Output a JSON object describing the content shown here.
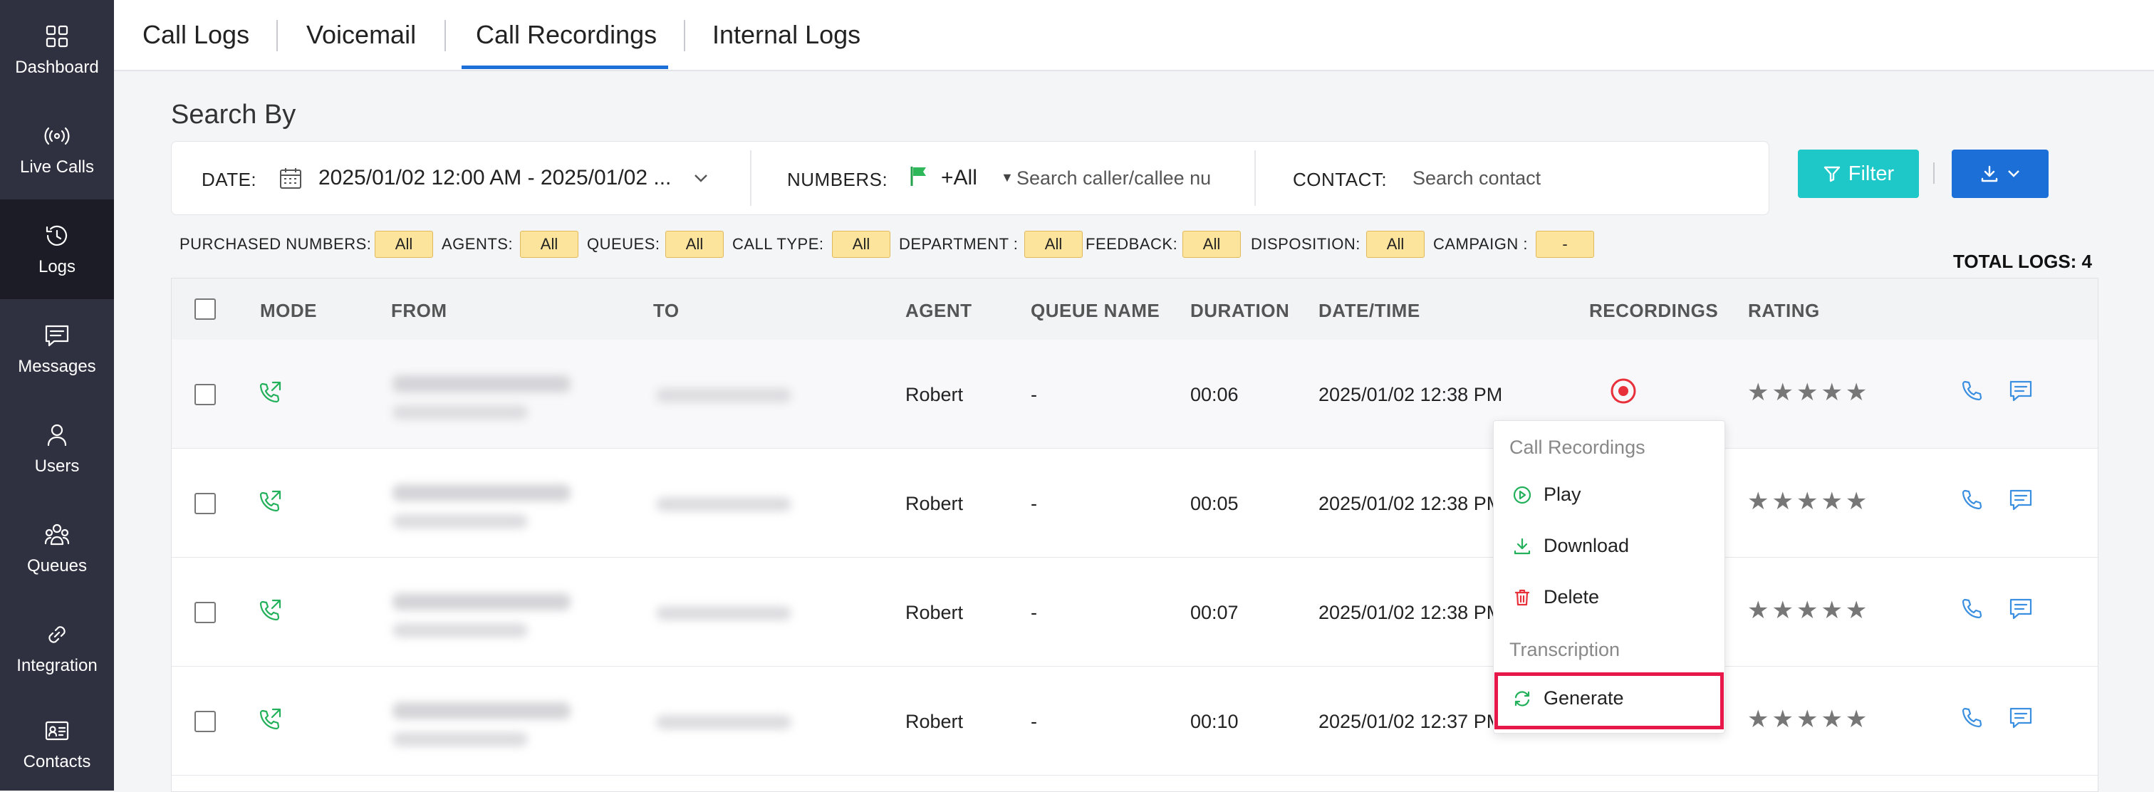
{
  "sidebar": {
    "items": [
      {
        "label": "Dashboard",
        "icon": "dashboard-icon"
      },
      {
        "label": "Live Calls",
        "icon": "live-calls-icon"
      },
      {
        "label": "Logs",
        "icon": "logs-icon",
        "active": true
      },
      {
        "label": "Messages",
        "icon": "messages-icon"
      },
      {
        "label": "Users",
        "icon": "users-icon"
      },
      {
        "label": "Queues",
        "icon": "queues-icon"
      },
      {
        "label": "Integration",
        "icon": "integration-icon"
      },
      {
        "label": "Contacts",
        "icon": "contacts-icon"
      }
    ]
  },
  "tabs": [
    {
      "label": "Call Logs"
    },
    {
      "label": "Voicemail"
    },
    {
      "label": "Call Recordings",
      "active": true
    },
    {
      "label": "Internal Logs"
    }
  ],
  "search": {
    "title": "Search By",
    "date_label": "DATE:",
    "date_value": "2025/01/02 12:00 AM - 2025/01/02 ...",
    "numbers_label": "NUMBERS:",
    "numbers_value": "+All",
    "numbers_placeholder": "Search caller/callee nu",
    "contact_label": "CONTACT:",
    "contact_placeholder": "Search contact"
  },
  "buttons": {
    "filter": "Filter"
  },
  "chips": [
    {
      "label": "PURCHASED NUMBERS:",
      "value": "All"
    },
    {
      "label": "AGENTS:",
      "value": "All"
    },
    {
      "label": "QUEUES:",
      "value": "All"
    },
    {
      "label": "CALL TYPE:",
      "value": "All"
    },
    {
      "label": "DEPARTMENT :",
      "value": "All"
    },
    {
      "label": "FEEDBACK:",
      "value": "All"
    },
    {
      "label": "DISPOSITION:",
      "value": "All"
    },
    {
      "label": "CAMPAIGN :",
      "value": "-"
    }
  ],
  "total_logs": "TOTAL LOGS: 4",
  "table": {
    "columns": [
      "MODE",
      "FROM",
      "TO",
      "AGENT",
      "QUEUE NAME",
      "DURATION",
      "DATE/TIME",
      "RECORDINGS",
      "RATING"
    ],
    "rows": [
      {
        "agent": "Robert",
        "queue": "-",
        "duration": "00:06",
        "datetime": "2025/01/02 12:38 PM"
      },
      {
        "agent": "Robert",
        "queue": "-",
        "duration": "00:05",
        "datetime": "2025/01/02 12:38 PM"
      },
      {
        "agent": "Robert",
        "queue": "-",
        "duration": "00:07",
        "datetime": "2025/01/02 12:38 PM"
      },
      {
        "agent": "Robert",
        "queue": "-",
        "duration": "00:10",
        "datetime": "2025/01/02 12:37 PM"
      }
    ],
    "rating_stars": "★★★★★"
  },
  "menu": {
    "section_recordings": "Call Recordings",
    "play": "Play",
    "download": "Download",
    "delete": "Delete",
    "section_transcription": "Transcription",
    "generate": "Generate"
  },
  "colors": {
    "sidebar_bg": "#2f3140",
    "active_tab": "#1d6fd8",
    "filter_button": "#1ec8c8",
    "green_icon": "#22b05a",
    "record_red": "#e8303a",
    "highlight": "#e8174a",
    "chip_bg": "#fde49c"
  }
}
